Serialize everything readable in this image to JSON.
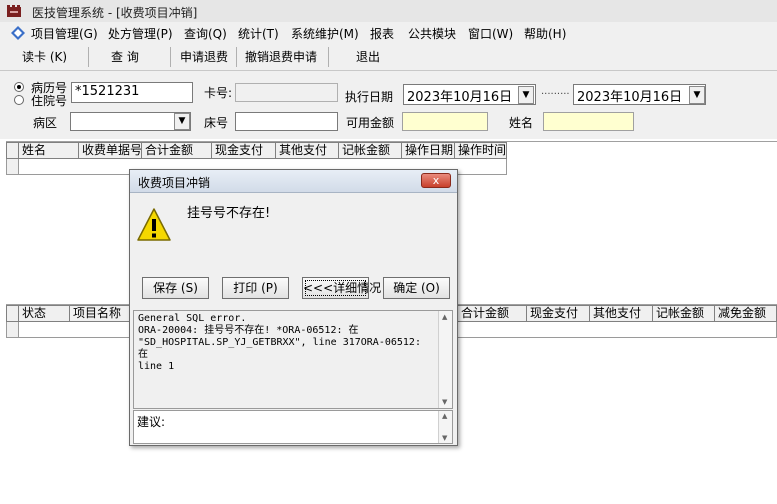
{
  "window": {
    "title": "医技管理系统 - [收费项目冲销]"
  },
  "menu": [
    "项目管理(G)",
    "处方管理(P)",
    "查询(Q)",
    "统计(T)",
    "系统维护(M)",
    "报表",
    "公共模块",
    "窗口(W)",
    "帮助(H)"
  ],
  "toolbar": {
    "read_card": "读卡 (K)",
    "query": "查   询",
    "apply_refund": "申请退费",
    "cancel_refund": "撤销退费申请",
    "exit": "退出"
  },
  "form": {
    "radio_record": "病历号",
    "radio_inpatient": "住院号",
    "patient_no_value": "*1521231",
    "card_no_label": "卡号:",
    "card_no_value": "",
    "exec_date_label": "执行日期",
    "date_from": "2023年10月16日",
    "date_to": "2023年10月16日",
    "date_sep": ".........",
    "ward_label": "病区",
    "ward_value": "",
    "bed_label": "床号",
    "bed_value": "",
    "available_label": "可用金额",
    "available_value": "",
    "name_label": "姓名",
    "name_value": ""
  },
  "top_grid": {
    "columns": [
      "姓名",
      "收费单据号",
      "合计金额",
      "现金支付",
      "其他支付",
      "记帐金额",
      "操作日期",
      "操作时间"
    ]
  },
  "bottom_grid": {
    "columns_left": [
      "状态",
      "项目名称"
    ],
    "columns_right": [
      "合计金额",
      "现金支付",
      "其他支付",
      "记帐金额",
      "减免金额"
    ]
  },
  "dialog": {
    "title": "收费项目冲销",
    "close": "x",
    "icon": "warning-icon",
    "message": "挂号号不存在!",
    "buttons": {
      "save": "保存 (S)",
      "print": "打印 (P)",
      "details": "<<<详细情况",
      "ok": "确定 (O)"
    },
    "error_text": "General SQL error.\nORA-20004: 挂号号不存在! *ORA-06512: 在\n\"SD_HOSPITAL.SP_YJ_GETBRXX\", line 317ORA-06512: 在\nline 1",
    "suggest_label": "建议:"
  },
  "colors": {
    "yellow_field": "#ffffd0",
    "warning": "#f5d800"
  }
}
